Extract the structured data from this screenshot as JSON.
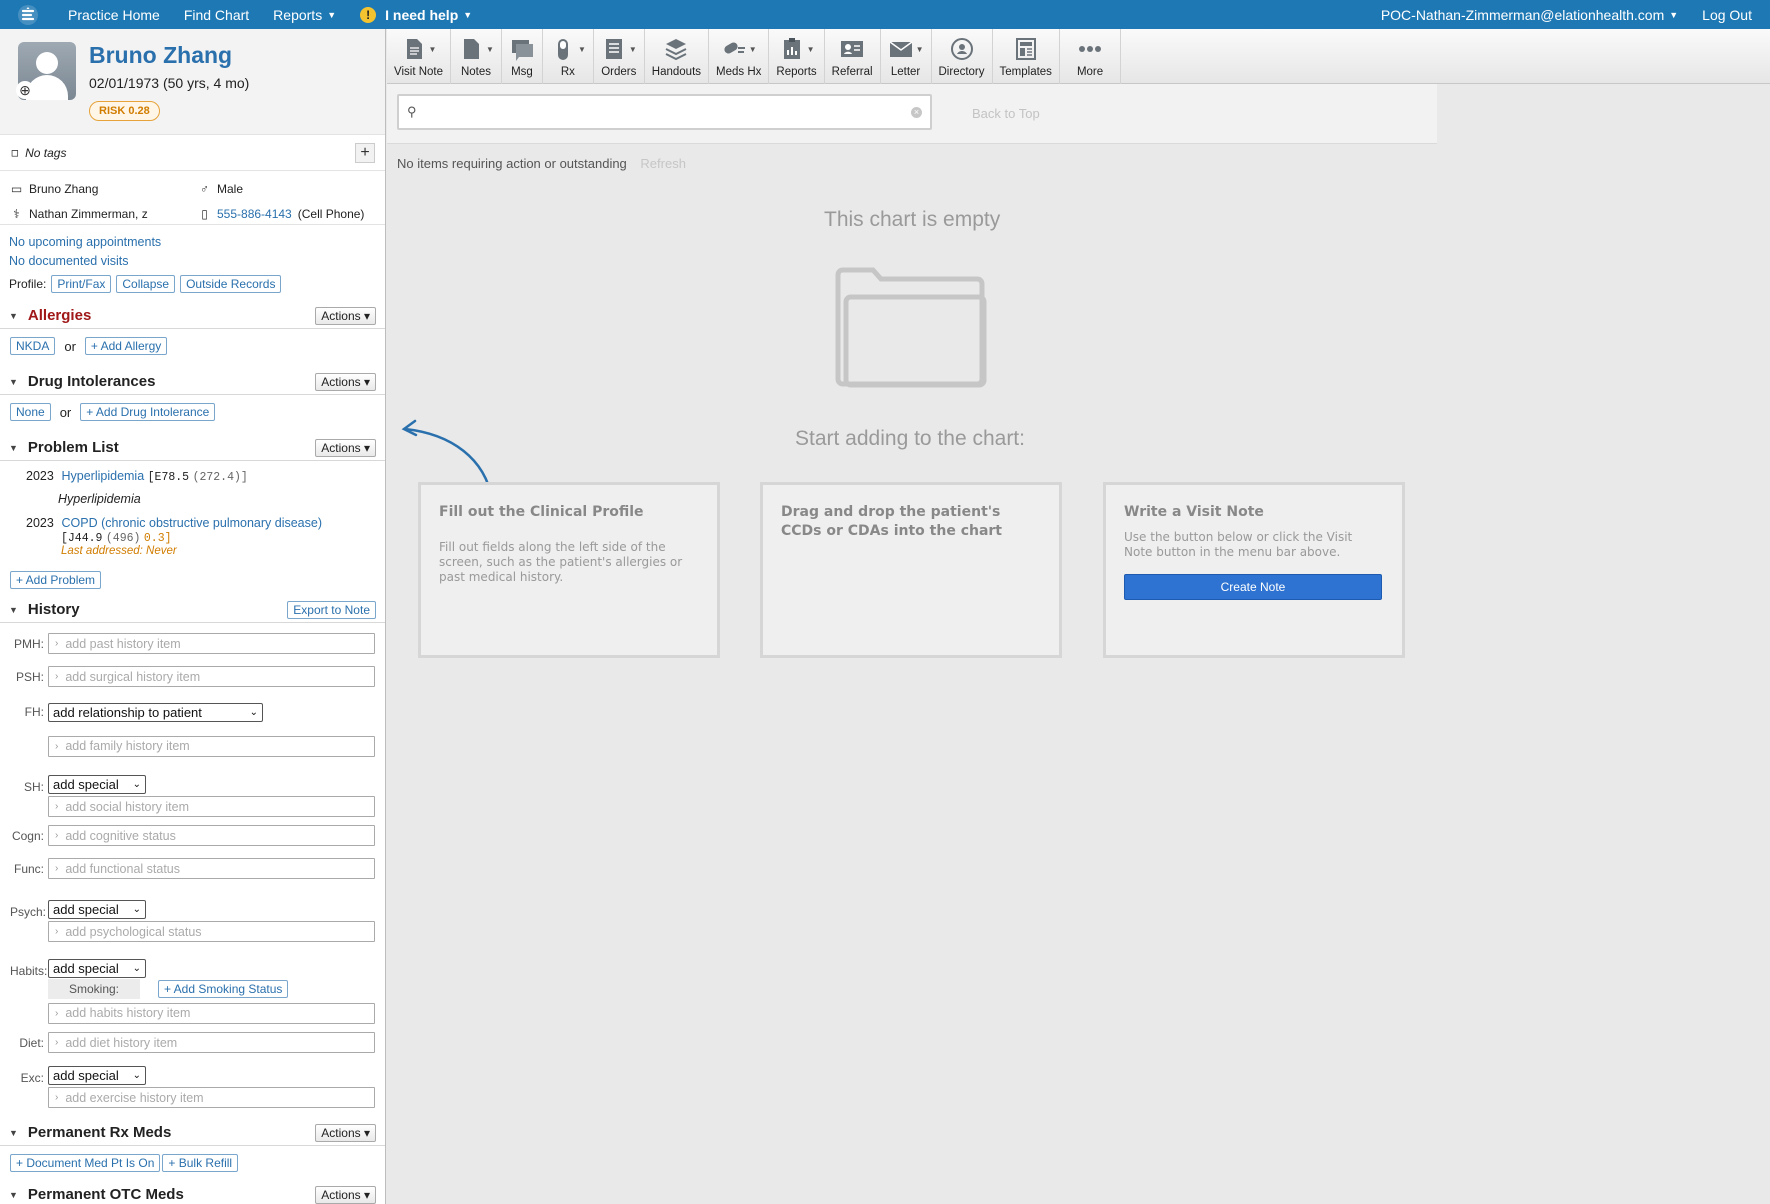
{
  "topbar": {
    "items": [
      "Practice Home",
      "Find Chart",
      "Reports"
    ],
    "help": "I need help",
    "user": "POC-Nathan-Zimmerman@elationhealth.com",
    "logout": "Log Out"
  },
  "patient": {
    "name": "Bruno Zhang",
    "dob": "02/01/1973 (50 yrs, 4 mo)",
    "risk": "RISK 0.28",
    "tags": "No tags",
    "display_name": "Bruno Zhang",
    "sex": "Male",
    "provider": "Nathan Zimmerman, z",
    "phone": "555-886-4143",
    "phone_type": "(Cell Phone)",
    "appointments": "No upcoming appointments",
    "visits": "No documented visits"
  },
  "profile": {
    "label": "Profile:",
    "buttons": [
      "Print/Fax",
      "Collapse",
      "Outside Records"
    ]
  },
  "actions_label": "Actions",
  "or": "or",
  "allergies": {
    "title": "Allergies",
    "nkda": "NKDA",
    "add": "+ Add Allergy"
  },
  "intolerances": {
    "title": "Drug Intolerances",
    "none": "None",
    "add": "+ Add Drug Intolerance"
  },
  "problems": {
    "title": "Problem List",
    "items": [
      {
        "year": "2023",
        "name": "Hyperlipidemia",
        "code": "[E78.5",
        "code2": "(272.4)]",
        "desc": "Hyperlipidemia"
      },
      {
        "year": "2023",
        "name": "COPD (chronic obstructive pulmonary disease)",
        "code": "[J44.9",
        "code2": "(496)",
        "score": "0.3]",
        "last": "Last addressed: Never"
      }
    ],
    "add": "+ Add Problem"
  },
  "history": {
    "title": "History",
    "export": "Export to Note",
    "pmh": {
      "label": "PMH:",
      "placeholder": "add past history item"
    },
    "psh": {
      "label": "PSH:",
      "placeholder": "add surgical history item"
    },
    "fh": {
      "label": "FH:",
      "select": "add relationship to patient",
      "placeholder": "add family history item"
    },
    "sh": {
      "label": "SH:",
      "select": "add special",
      "placeholder": "add social history item"
    },
    "cogn": {
      "label": "Cogn:",
      "placeholder": "add cognitive status"
    },
    "func": {
      "label": "Func:",
      "placeholder": "add functional status"
    },
    "psych": {
      "label": "Psych:",
      "select": "add special",
      "placeholder": "add psychological status"
    },
    "habits": {
      "label": "Habits:",
      "select": "add special",
      "smoking": "Smoking:",
      "smoking_btn": "+ Add Smoking Status",
      "placeholder": "add habits history item"
    },
    "diet": {
      "label": "Diet:",
      "placeholder": "add diet history item"
    },
    "exc": {
      "label": "Exc:",
      "select": "add special",
      "placeholder": "add exercise history item"
    }
  },
  "rx_meds": {
    "title": "Permanent Rx Meds",
    "document": "+ Document Med Pt Is On",
    "refill": "+ Bulk Refill"
  },
  "otc_meds": {
    "title": "Permanent OTC Meds"
  },
  "toolbar": [
    "Visit Note",
    "Notes",
    "Msg",
    "Rx",
    "Orders",
    "Handouts",
    "Meds Hx",
    "Reports",
    "Referral",
    "Letter",
    "Directory",
    "Templates",
    "More"
  ],
  "main": {
    "search_placeholder": "",
    "back_to_top": "Back to Top",
    "status": "No items requiring action or outstanding",
    "refresh": "Refresh",
    "empty": "This chart is empty",
    "start": "Start adding to the chart:",
    "cards": [
      {
        "title": "Fill out the Clinical Profile",
        "body": "Fill out fields along the left side of the screen, such as the patient's allergies or past medical history."
      },
      {
        "title": "Drag and drop the patient's CCDs or CDAs into the chart",
        "body": ""
      },
      {
        "title": "Write a Visit Note",
        "body": "Use the button below or click the Visit Note button in the menu bar above.",
        "button": "Create Note"
      }
    ]
  },
  "colors": {
    "topbar": "#1e78b4",
    "link": "#2a70ad",
    "allergy_title": "#a01818",
    "create_button": "#2e73d1",
    "risk": "#d17d00"
  }
}
